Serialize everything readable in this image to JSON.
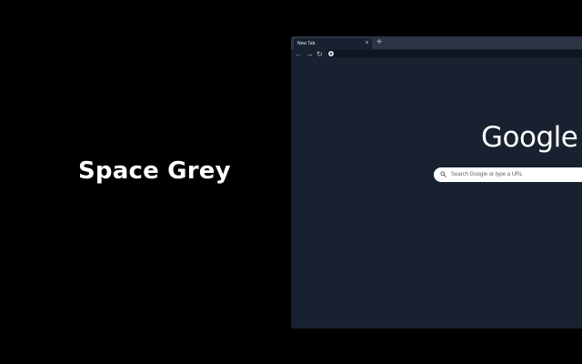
{
  "promo": {
    "title": "Space Grey"
  },
  "browser": {
    "tab": {
      "title": "New Tab",
      "close_icon": "close-icon"
    },
    "new_tab_icon": "plus-icon",
    "toolbar": {
      "back_icon": "arrow-left-icon",
      "forward_icon": "arrow-right-icon",
      "reload_icon": "reload-icon",
      "site_icon": "google-g-icon",
      "omnibox_value": ""
    },
    "page": {
      "logo": "Google",
      "search_placeholder": "Search Google or type a URL",
      "search_icon": "search-icon"
    }
  },
  "colors": {
    "background": "#000000",
    "theme_frame": "#2b3543",
    "theme_page": "#18212f",
    "text_light": "#ffffff"
  }
}
